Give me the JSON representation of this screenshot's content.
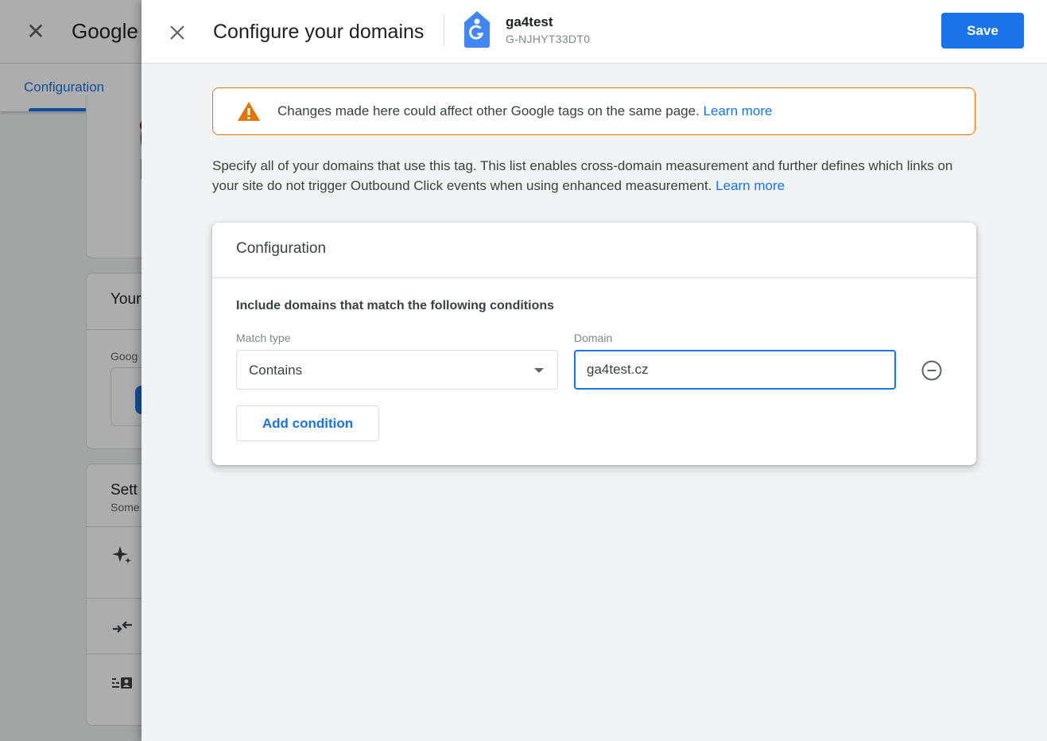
{
  "background": {
    "title": "Google",
    "tab_label": "Configuration",
    "card2_title": "Your",
    "card2_sub": "Goog",
    "card3_title": "Sett",
    "card3_sub": "Some",
    "icons": [
      "sparkle-icon",
      "merge-arrows-icon",
      "list-person-icon"
    ]
  },
  "panel": {
    "title": "Configure your domains",
    "tag": {
      "name": "ga4test",
      "id": "G-NJHYT33DT0",
      "icon": "google-tag-icon"
    },
    "save_label": "Save",
    "colors": {
      "accent": "#1a73e8",
      "warning": "#e37400"
    }
  },
  "warning": {
    "text": "Changes made here could affect other Google tags on the same page.",
    "link": "Learn more"
  },
  "description": {
    "text": "Specify all of your domains that use this tag. This list enables cross-domain measurement and further defines which links on your site do not trigger Outbound Click events when using enhanced measurement.",
    "link": "Learn more"
  },
  "config": {
    "title": "Configuration",
    "conditions_label": "Include domains that match the following conditions",
    "match_type_label": "Match type",
    "match_type_value": "Contains",
    "domain_label": "Domain",
    "domain_value": "ga4test.cz",
    "add_condition_label": "Add condition"
  }
}
